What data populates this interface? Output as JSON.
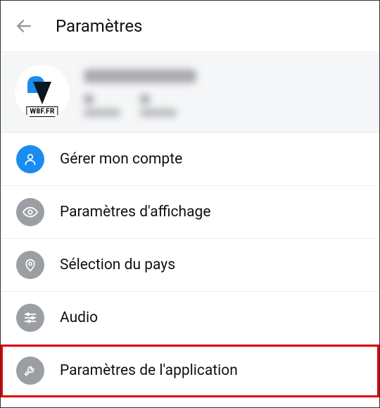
{
  "header": {
    "title": "Paramètres"
  },
  "profile": {
    "avatar_badge": "W8F.FR"
  },
  "colors": {
    "accent": "#1a8cf0",
    "grey_icon": "#9b9fa4"
  },
  "menu": {
    "items": [
      {
        "label": "Gérer mon compte",
        "icon": "person-icon",
        "highlight": false,
        "accent": true
      },
      {
        "label": "Paramètres d'affichage",
        "icon": "eye-icon",
        "highlight": false,
        "accent": false
      },
      {
        "label": "Sélection du pays",
        "icon": "location-pin-icon",
        "highlight": false,
        "accent": false
      },
      {
        "label": "Audio",
        "icon": "sliders-icon",
        "highlight": false,
        "accent": false
      },
      {
        "label": "Paramètres de l'application",
        "icon": "wrench-icon",
        "highlight": true,
        "accent": false
      }
    ]
  }
}
